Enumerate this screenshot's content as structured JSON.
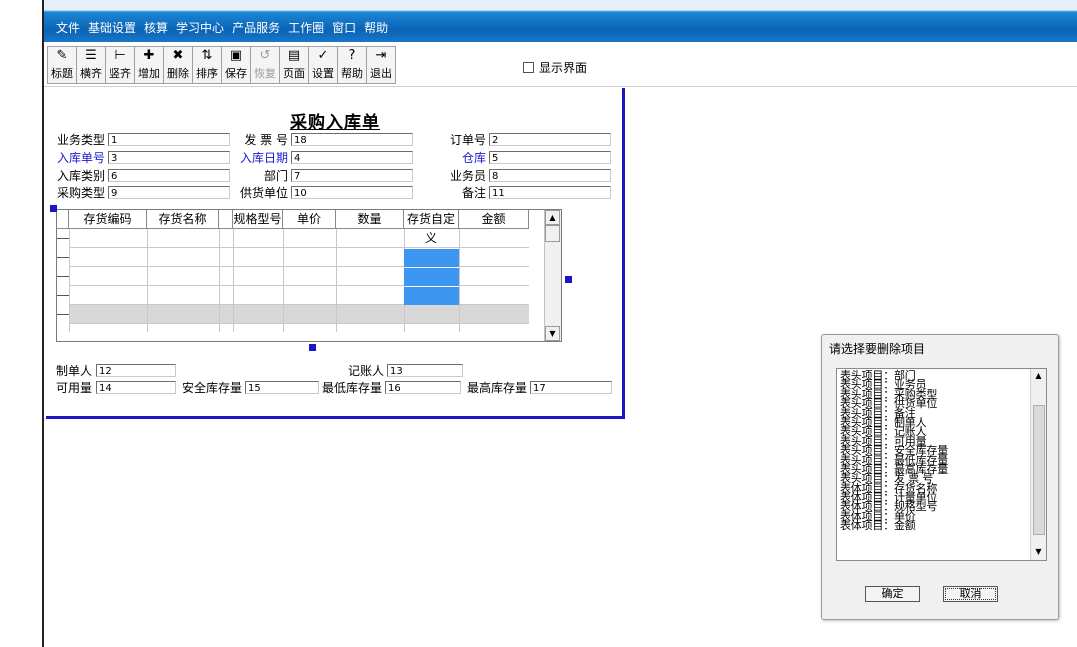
{
  "menu": [
    "文件",
    "基础设置",
    "核算",
    "学习中心",
    "产品服务",
    "工作圈",
    "窗口",
    "帮助"
  ],
  "toolbar": [
    {
      "label": "标题",
      "icon": "title-icon",
      "glyph": "✎",
      "enabled": true
    },
    {
      "label": "横齐",
      "icon": "align-horizontal-icon",
      "glyph": "☰",
      "enabled": true
    },
    {
      "label": "竖齐",
      "icon": "align-vertical-icon",
      "glyph": "⊢",
      "enabled": true
    },
    {
      "label": "增加",
      "icon": "add-icon",
      "glyph": "✚",
      "enabled": true
    },
    {
      "label": "删除",
      "icon": "delete-icon",
      "glyph": "✖",
      "enabled": true
    },
    {
      "label": "排序",
      "icon": "sort-icon",
      "glyph": "⇅",
      "enabled": true
    },
    {
      "label": "保存",
      "icon": "save-icon",
      "glyph": "▣",
      "enabled": true
    },
    {
      "label": "恢复",
      "icon": "restore-icon",
      "glyph": "↺",
      "enabled": false
    },
    {
      "label": "页面",
      "icon": "page-icon",
      "glyph": "▤",
      "enabled": true
    },
    {
      "label": "设置",
      "icon": "settings-icon",
      "glyph": "✓",
      "enabled": true
    },
    {
      "label": "帮助",
      "icon": "help-icon",
      "glyph": "?",
      "enabled": true
    },
    {
      "label": "退出",
      "icon": "exit-icon",
      "glyph": "⇥",
      "enabled": true
    }
  ],
  "show_ui_label": "显示界面",
  "form": {
    "title": "采购入库单",
    "header_fields": [
      {
        "label": "业务类型",
        "value": "1",
        "blue": false
      },
      {
        "label": "发 票 号",
        "value": "18",
        "blue": false
      },
      {
        "label": "订单号",
        "value": "2",
        "blue": false
      },
      {
        "label": "入库单号",
        "value": "3",
        "blue": true
      },
      {
        "label": "入库日期",
        "value": "4",
        "blue": true
      },
      {
        "label": "仓库",
        "value": "5",
        "blue": true
      },
      {
        "label": "入库类别",
        "value": "6",
        "blue": false
      },
      {
        "label": "部门",
        "value": "7",
        "blue": false
      },
      {
        "label": "业务员",
        "value": "8",
        "blue": false
      },
      {
        "label": "采购类型",
        "value": "9",
        "blue": false
      },
      {
        "label": "供货单位",
        "value": "10",
        "blue": false
      },
      {
        "label": "备注",
        "value": "11",
        "blue": false
      }
    ],
    "grid_columns": [
      "存货编码",
      "存货名称",
      "",
      "规格型号",
      "单价",
      "数量",
      "存货自定义",
      "金额"
    ],
    "footer_fields": [
      {
        "label": "制单人",
        "value": "12"
      },
      {
        "label": "记账人",
        "value": "13"
      },
      {
        "label": "可用量",
        "value": "14"
      },
      {
        "label": "安全库存量",
        "value": "15"
      },
      {
        "label": "最低库存量",
        "value": "16"
      },
      {
        "label": "最高库存量",
        "value": "17"
      }
    ]
  },
  "dialog": {
    "title": "请选择要删除项目",
    "items": [
      "表头项目：部门",
      "表头项目：业务员",
      "表头项目：采购类型",
      "表头项目：供货单位",
      "表头项目：备注",
      "表头项目：制单人",
      "表头项目：记账人",
      "表头项目：可用量",
      "表头项目：安全库存量",
      "表头项目：最低库存量",
      "表头项目：最高库存量",
      "表头项目：发 票 号",
      "表体项目：存货名称",
      "表体项目：计量单位",
      "表体项目：规格型号",
      "表体项目：单价",
      "表体项目：金额"
    ],
    "ok_label": "确定",
    "cancel_label": "取消"
  }
}
